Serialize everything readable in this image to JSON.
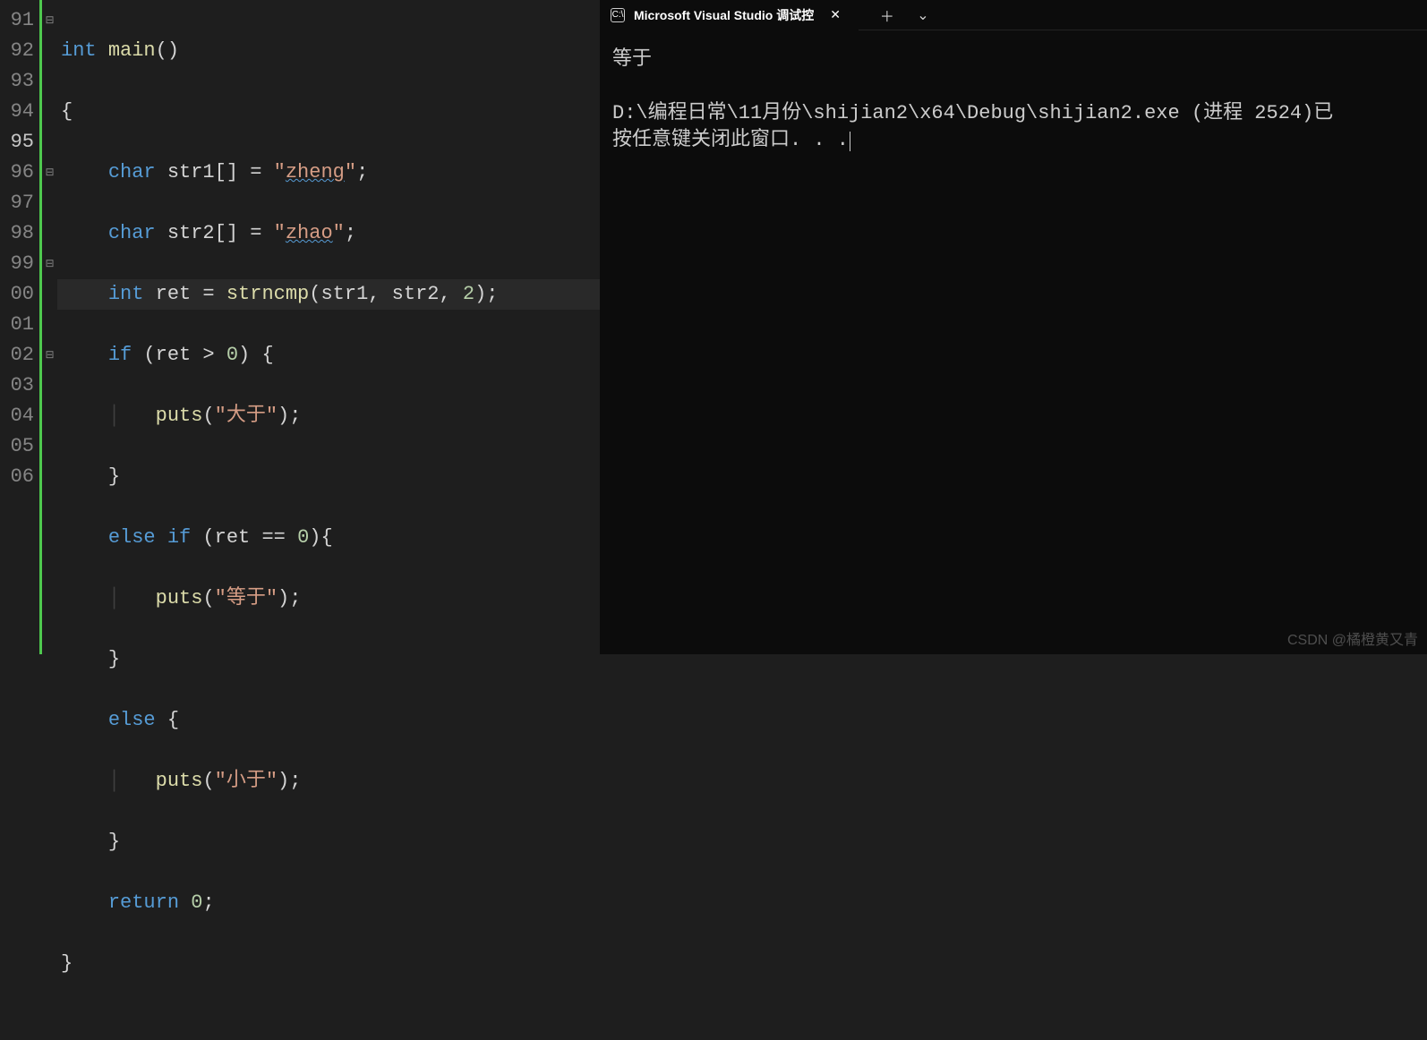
{
  "editor": {
    "line_numbers": [
      "91",
      "92",
      "93",
      "94",
      "95",
      "96",
      "97",
      "98",
      "99",
      "00",
      "01",
      "02",
      "03",
      "04",
      "05",
      "06"
    ],
    "current_line_index": 4,
    "fold_markers": {
      "0": "⊟",
      "5": "⊟",
      "8": "⊟",
      "11": "⊟"
    },
    "code": {
      "l91": {
        "kw1": "int",
        "fn": "main",
        "rest": "()"
      },
      "l92": {
        "text": "{"
      },
      "l93": {
        "kw": "char",
        "var": "str1[]",
        "eq": " = ",
        "str": "\"zheng\"",
        "semi": ";"
      },
      "l94": {
        "kw": "char",
        "var": "str2[]",
        "eq": " = ",
        "str": "\"zhao\"",
        "semi": ";"
      },
      "l95": {
        "kw": "int",
        "var": "ret",
        "eq": " = ",
        "fn": "strncmp",
        "args": "(str1, str2, ",
        "num": "2",
        "rest": ");"
      },
      "l96": {
        "kw": "if",
        "cond": " (ret > ",
        "num": "0",
        "rest": ") {"
      },
      "l97": {
        "fn": "puts",
        "open": "(",
        "str": "\"大于\"",
        "rest": ");"
      },
      "l98": {
        "text": "}"
      },
      "l99": {
        "kw1": "else",
        "kw2": "if",
        "cond": " (ret == ",
        "num": "0",
        "rest": "){"
      },
      "l100": {
        "fn": "puts",
        "open": "(",
        "str": "\"等于\"",
        "rest": ");"
      },
      "l101": {
        "text": "}"
      },
      "l102": {
        "kw": "else",
        "rest": " {"
      },
      "l103": {
        "fn": "puts",
        "open": "(",
        "str": "\"小于\"",
        "rest": ");"
      },
      "l104": {
        "text": "}"
      },
      "l105": {
        "kw": "return",
        "num": "0",
        "semi": ";"
      },
      "l106": {
        "text": "}"
      }
    }
  },
  "terminal": {
    "tab_title": "Microsoft Visual Studio 调试控",
    "tab_icon_text": "C:\\",
    "output_line1": "等于",
    "output_blank": "",
    "output_line2": "D:\\编程日常\\11月份\\shijian2\\x64\\Debug\\shijian2.exe (进程 2524)已",
    "output_line3": "按任意键关闭此窗口. . ."
  },
  "watermark": "CSDN @橘橙黄又青"
}
